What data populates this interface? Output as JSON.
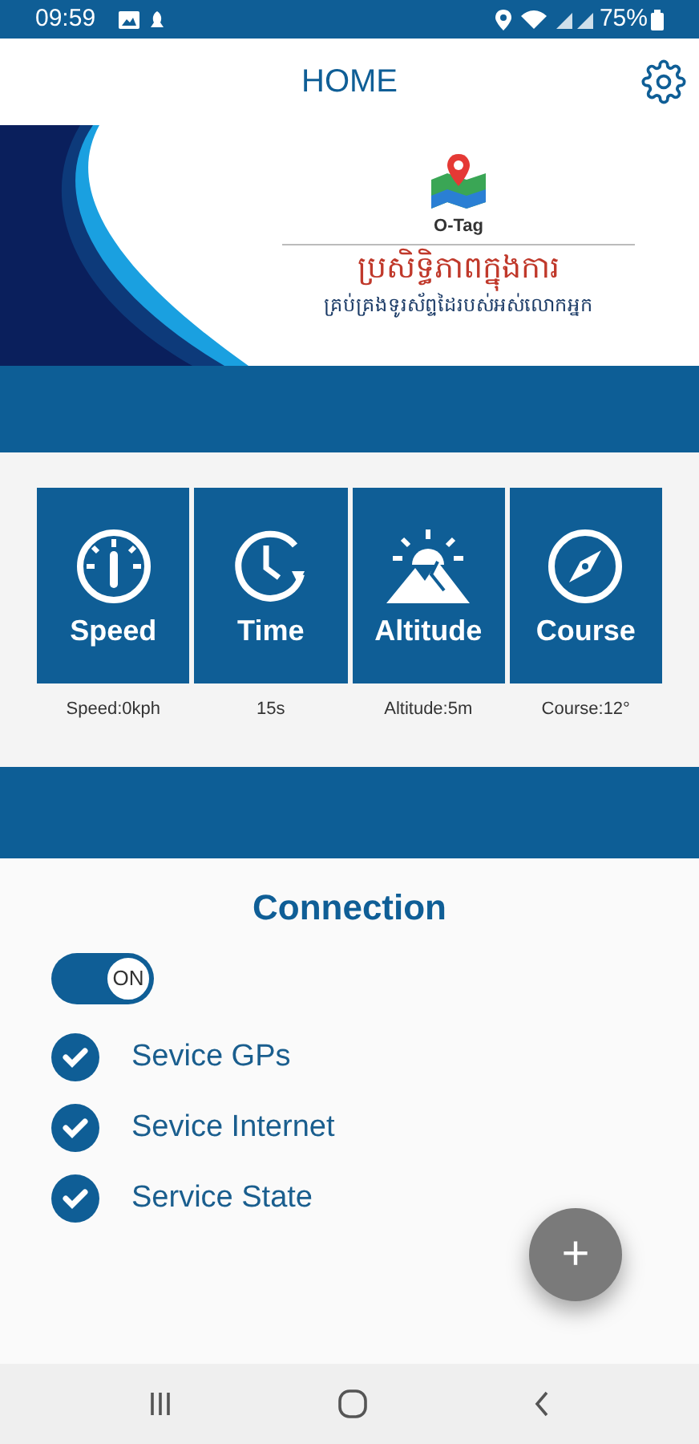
{
  "status_bar": {
    "time": "09:59",
    "battery": "75%"
  },
  "header": {
    "title": "HOME"
  },
  "banner": {
    "brand": "O-Tag",
    "headline": "ប្រសិទ្ធិភាពក្នុងការ",
    "tagline": "គ្រប់គ្រងទូរស័ព្ទដៃរបស់អស់លោកអ្នក"
  },
  "tiles": [
    {
      "kind": "speed",
      "label": "Speed",
      "reading": "Speed:0kph"
    },
    {
      "kind": "time",
      "label": "Time",
      "reading": "15s"
    },
    {
      "kind": "altitude",
      "label": "Altitude",
      "reading": "Altitude:5m"
    },
    {
      "kind": "course",
      "label": "Course",
      "reading": "Course:12°"
    }
  ],
  "connection": {
    "title": "Connection",
    "toggle": {
      "label": "ON",
      "on": true
    },
    "services": [
      {
        "label": "Sevice GPs",
        "checked": true
      },
      {
        "label": "Sevice Internet",
        "checked": true
      },
      {
        "label": "Service State",
        "checked": true
      }
    ]
  },
  "fab": {
    "label": "+"
  }
}
